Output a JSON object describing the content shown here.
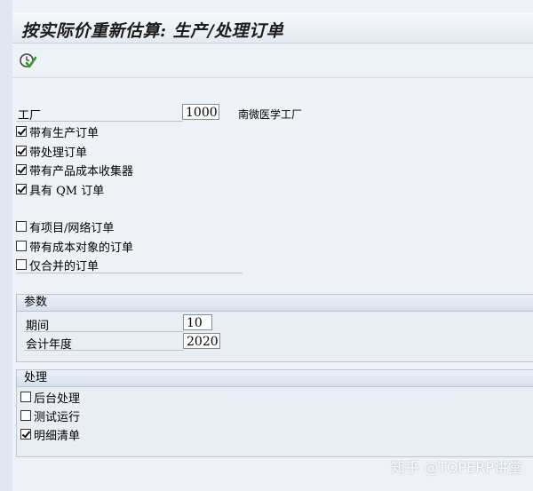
{
  "title": "按实际价重新估算: 生产/处理订单",
  "toolbar": {
    "execute_icon": "execute-clock-check-icon"
  },
  "plant": {
    "label": "工厂",
    "value": "1000",
    "description": "南微医学工厂"
  },
  "order_types": [
    {
      "label": "带有生产订单",
      "checked": true
    },
    {
      "label": "带处理订单",
      "checked": true
    },
    {
      "label": "带有产品成本收集器",
      "checked": true
    },
    {
      "label": "具有 QM 订单",
      "checked": true
    }
  ],
  "other_orders": [
    {
      "label": "有项目/网络订单",
      "checked": false
    },
    {
      "label": "带有成本对象的订单",
      "checked": false
    },
    {
      "label": "仅合并的订单",
      "checked": false
    }
  ],
  "params": {
    "title": "参数",
    "period_label": "期间",
    "period_value": "10",
    "year_label": "会计年度",
    "year_value": "2020"
  },
  "processing": {
    "title": "处理",
    "options": [
      {
        "label": "后台处理",
        "checked": false
      },
      {
        "label": "测试运行",
        "checked": false
      },
      {
        "label": "明细清单",
        "checked": true
      }
    ]
  },
  "watermark": "知乎 @TOPERP讲堂",
  "colors": {
    "background": "#eef2f6",
    "group_header": "#d7e0ea",
    "input_border": "#7f8ea0"
  }
}
